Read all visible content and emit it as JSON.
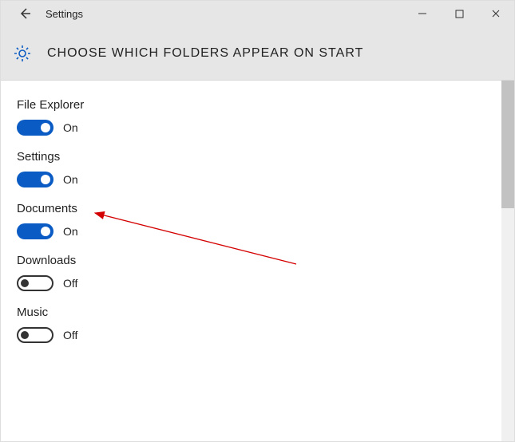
{
  "titlebar": {
    "title": "Settings"
  },
  "header": {
    "page_title": "CHOOSE WHICH FOLDERS APPEAR ON START"
  },
  "options": [
    {
      "label": "File Explorer",
      "state": "On",
      "on": true
    },
    {
      "label": "Settings",
      "state": "On",
      "on": true
    },
    {
      "label": "Documents",
      "state": "On",
      "on": true
    },
    {
      "label": "Downloads",
      "state": "Off",
      "on": false
    },
    {
      "label": "Music",
      "state": "Off",
      "on": false
    }
  ],
  "colors": {
    "accent": "#0a5bc4",
    "arrow": "#d40000"
  }
}
